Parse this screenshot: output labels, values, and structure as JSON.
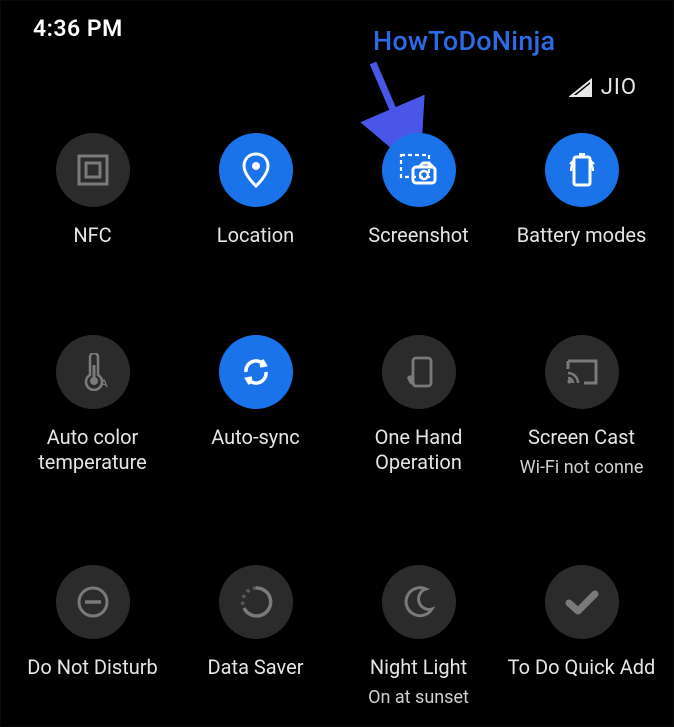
{
  "status": {
    "time": "4:36 PM",
    "carrier": "JIO"
  },
  "annotation": {
    "text": "HowToDoNinja"
  },
  "tiles": [
    {
      "id": "nfc",
      "label": "NFC",
      "sublabel": "",
      "active": false
    },
    {
      "id": "location",
      "label": "Location",
      "sublabel": "",
      "active": true
    },
    {
      "id": "screenshot",
      "label": "Screenshot",
      "sublabel": "",
      "active": true
    },
    {
      "id": "battery",
      "label": "Battery modes",
      "sublabel": "",
      "active": true
    },
    {
      "id": "autocolor",
      "label": "Auto color temperature",
      "sublabel": "",
      "active": false
    },
    {
      "id": "autosync",
      "label": "Auto-sync",
      "sublabel": "",
      "active": true
    },
    {
      "id": "onehand",
      "label": "One Hand Operation",
      "sublabel": "",
      "active": false
    },
    {
      "id": "screencast",
      "label": "Screen Cast",
      "sublabel": "Wi-Fi not conne",
      "active": false
    },
    {
      "id": "dnd",
      "label": "Do Not Disturb",
      "sublabel": "",
      "active": false
    },
    {
      "id": "datasaver",
      "label": "Data Saver",
      "sublabel": "",
      "active": false
    },
    {
      "id": "nightlight",
      "label": "Night Light",
      "sublabel": "On at sunset",
      "active": false
    },
    {
      "id": "todoquick",
      "label": "To Do Quick Add",
      "sublabel": "",
      "active": false
    }
  ]
}
